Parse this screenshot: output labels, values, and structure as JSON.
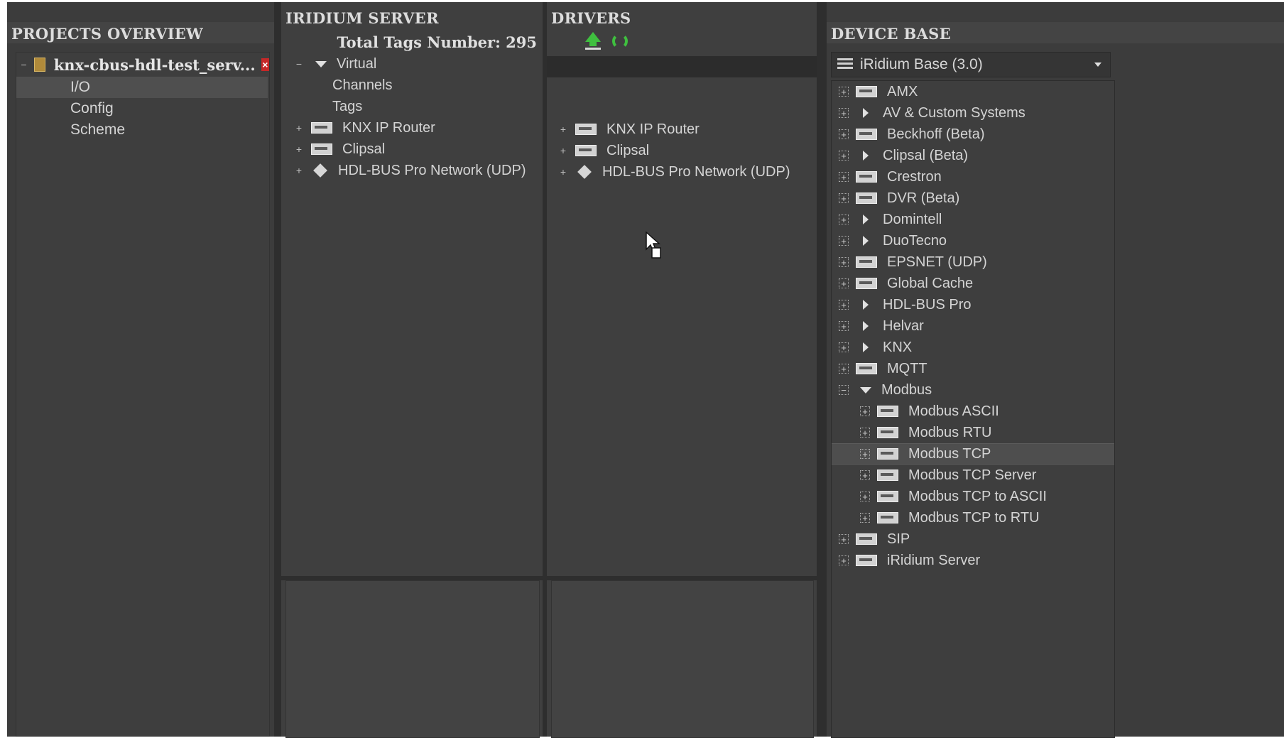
{
  "projects": {
    "title": "PROJECTS OVERVIEW",
    "project_name": "knx-cbus-hdl-test_serv...",
    "items": [
      "I/O",
      "Config",
      "Scheme"
    ]
  },
  "server": {
    "title": "IRIDIUM SERVER",
    "total_tags": "Total Tags Number: 295",
    "tree": [
      {
        "label": "Virtual",
        "expander": "−",
        "icon": "triangle-down"
      },
      {
        "label": "Channels",
        "expander": "",
        "icon": ""
      },
      {
        "label": "Tags",
        "expander": "",
        "icon": ""
      },
      {
        "label": "KNX IP Router",
        "expander": "+",
        "icon": "device"
      },
      {
        "label": "Clipsal",
        "expander": "+",
        "icon": "device"
      },
      {
        "label": "HDL-BUS Pro Network (UDP)",
        "expander": "+",
        "icon": "diamond"
      }
    ]
  },
  "drivers": {
    "title": "DRIVERS",
    "items": [
      {
        "label": "KNX IP Router",
        "expander": "+",
        "icon": "device"
      },
      {
        "label": "Clipsal",
        "expander": "+",
        "icon": "device"
      },
      {
        "label": "HDL-BUS Pro Network (UDP)",
        "expander": "+",
        "icon": "diamond"
      }
    ]
  },
  "device_base": {
    "title": "DEVICE BASE",
    "selected_base": "iRidium Base (3.0)",
    "items": [
      {
        "label": "AMX",
        "icon": "device",
        "level": 0,
        "expander": "+"
      },
      {
        "label": "AV & Custom Systems",
        "icon": "triangle-right",
        "level": 0,
        "expander": "+"
      },
      {
        "label": "Beckhoff (Beta)",
        "icon": "device",
        "level": 0,
        "expander": "+"
      },
      {
        "label": "Clipsal (Beta)",
        "icon": "triangle-right",
        "level": 0,
        "expander": "+"
      },
      {
        "label": "Crestron",
        "icon": "device",
        "level": 0,
        "expander": "+"
      },
      {
        "label": "DVR (Beta)",
        "icon": "device",
        "level": 0,
        "expander": "+"
      },
      {
        "label": "Domintell",
        "icon": "triangle-right",
        "level": 0,
        "expander": "+"
      },
      {
        "label": "DuoTecno",
        "icon": "triangle-right",
        "level": 0,
        "expander": "+"
      },
      {
        "label": "EPSNET (UDP)",
        "icon": "device",
        "level": 0,
        "expander": "+"
      },
      {
        "label": "Global Cache",
        "icon": "device",
        "level": 0,
        "expander": "+"
      },
      {
        "label": "HDL-BUS Pro",
        "icon": "triangle-right",
        "level": 0,
        "expander": "+"
      },
      {
        "label": "Helvar",
        "icon": "triangle-right",
        "level": 0,
        "expander": "+"
      },
      {
        "label": "KNX",
        "icon": "triangle-right",
        "level": 0,
        "expander": "+"
      },
      {
        "label": "MQTT",
        "icon": "device",
        "level": 0,
        "expander": "+"
      },
      {
        "label": "Modbus",
        "icon": "triangle-down",
        "level": 0,
        "expander": "−"
      },
      {
        "label": "Modbus ASCII",
        "icon": "device",
        "level": 1,
        "expander": "+"
      },
      {
        "label": "Modbus RTU",
        "icon": "device",
        "level": 1,
        "expander": "+"
      },
      {
        "label": "Modbus TCP",
        "icon": "device",
        "level": 1,
        "expander": "+",
        "selected": true
      },
      {
        "label": "Modbus TCP Server",
        "icon": "device",
        "level": 1,
        "expander": "+"
      },
      {
        "label": "Modbus TCP to ASCII",
        "icon": "device",
        "level": 1,
        "expander": "+"
      },
      {
        "label": "Modbus TCP to RTU",
        "icon": "device",
        "level": 1,
        "expander": "+"
      },
      {
        "label": "SIP",
        "icon": "device",
        "level": 0,
        "expander": "+"
      },
      {
        "label": "iRidium Server",
        "icon": "device",
        "level": 0,
        "expander": "+"
      }
    ]
  }
}
